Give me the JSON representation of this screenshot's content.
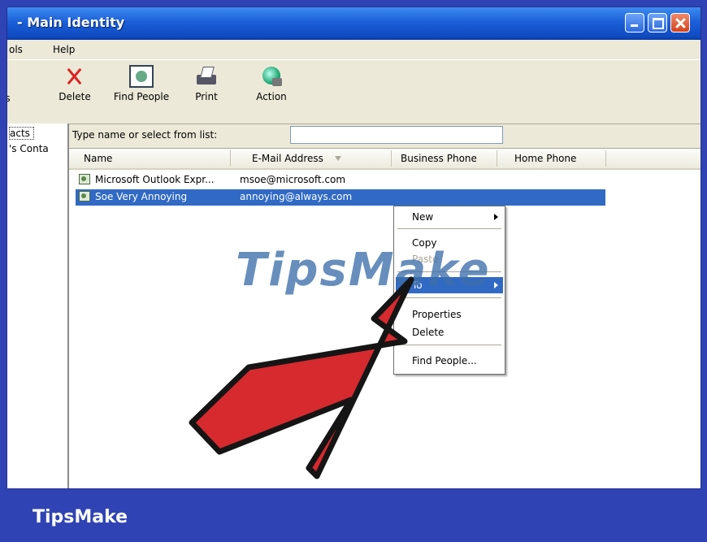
{
  "window": {
    "title": "- Main Identity"
  },
  "menubar": {
    "items": [
      "ols",
      "Help"
    ]
  },
  "toolbar": {
    "buttons": [
      {
        "label": "es",
        "icon": "addresses-icon"
      },
      {
        "label": "Delete",
        "icon": "delete-x-icon"
      },
      {
        "label": "Find People",
        "icon": "find-people-icon"
      },
      {
        "label": "Print",
        "icon": "printer-icon"
      },
      {
        "label": "Action",
        "icon": "action-globe-icon"
      }
    ]
  },
  "sidebar": {
    "items": [
      "acts",
      "'s Conta"
    ]
  },
  "search": {
    "label": "Type name or select from list:",
    "value": ""
  },
  "table": {
    "columns": [
      "Name",
      "E-Mail Address",
      "Business Phone",
      "Home Phone"
    ],
    "rows": [
      {
        "name": "Microsoft Outlook Expr...",
        "email": "msoe@microsoft.com",
        "selected": false
      },
      {
        "name": "Soe Very Annoying",
        "email": "annoying@always.com",
        "selected": true
      }
    ]
  },
  "context_menu": {
    "items": [
      {
        "label": "New",
        "submenu": true,
        "disabled": false
      },
      {
        "label": "Copy",
        "disabled": false
      },
      {
        "label": "Paste",
        "disabled": true
      },
      {
        "label": "To",
        "submenu": true,
        "highlighted": true
      },
      {
        "label": "Properties",
        "disabled": false
      },
      {
        "label": "Delete",
        "disabled": false
      },
      {
        "label": "Find People...",
        "disabled": false
      }
    ]
  },
  "watermark": "TipsMake",
  "branding": "TipsMake",
  "colors": {
    "background": "#2f43b4",
    "titlebar": "#1b5fd8",
    "selection": "#316ac5",
    "arrow": "#d62a2f"
  }
}
